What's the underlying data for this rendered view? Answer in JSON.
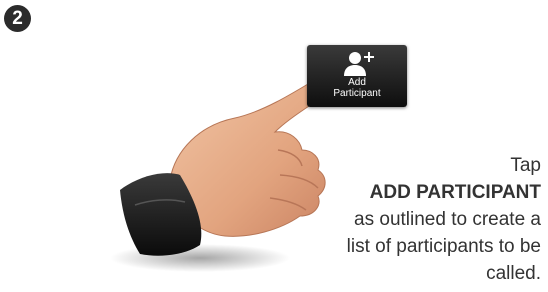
{
  "step": {
    "number": "2"
  },
  "button": {
    "label": "Add\nParticipant",
    "icon": "add-person-icon"
  },
  "instructions": {
    "line1": "Tap",
    "emphasis": "ADD PARTICIPANT",
    "line3": "as outlined to create a",
    "line4": "list of participants to be",
    "line5": "called."
  },
  "colors": {
    "button_bg": "#1a1a1a",
    "text": "#333333",
    "badge": "#2b2b2b"
  }
}
